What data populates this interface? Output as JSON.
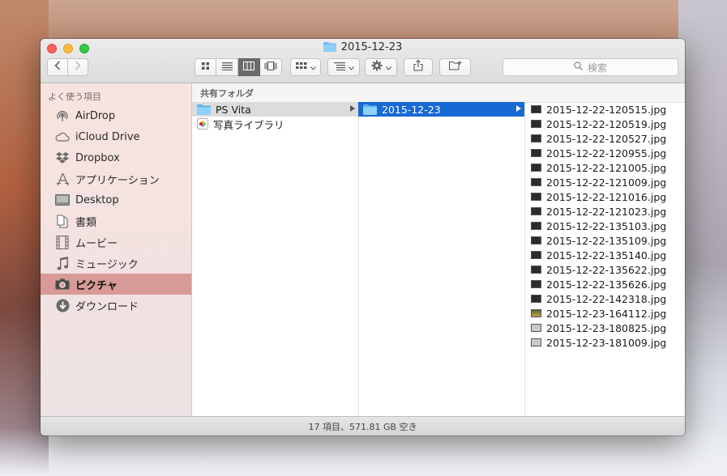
{
  "window": {
    "title": "2015-12-23"
  },
  "toolbar": {
    "back_icon": "chevron-left-icon",
    "forward_icon": "chevron-right-icon",
    "view_modes": [
      "icon-view-icon",
      "list-view-icon",
      "column-view-icon",
      "coverflow-view-icon"
    ],
    "active_view": "column-view-icon",
    "search_placeholder": "検索"
  },
  "sidebar": {
    "heading": "よく使う項目",
    "items": [
      {
        "label": "AirDrop",
        "icon": "airdrop-icon"
      },
      {
        "label": "iCloud Drive",
        "icon": "cloud-icon"
      },
      {
        "label": "Dropbox",
        "icon": "dropbox-icon"
      },
      {
        "label": "アプリケーション",
        "icon": "applications-icon"
      },
      {
        "label": "Desktop",
        "icon": "desktop-icon"
      },
      {
        "label": "書類",
        "icon": "documents-icon"
      },
      {
        "label": "ムービー",
        "icon": "movies-icon"
      },
      {
        "label": "ミュージック",
        "icon": "music-icon"
      },
      {
        "label": "ピクチャ",
        "icon": "camera-icon",
        "selected": true
      },
      {
        "label": "ダウンロード",
        "icon": "download-icon"
      }
    ]
  },
  "browser": {
    "path_header": "共有フォルダ",
    "column1": [
      {
        "label": "PS Vita",
        "kind": "folder",
        "selected": true
      },
      {
        "label": "写真ライブラリ",
        "kind": "library"
      }
    ],
    "column2": [
      {
        "label": "2015-12-23",
        "kind": "folder",
        "selected": true
      }
    ],
    "files": [
      {
        "name": "2015-12-22-120515.jpg",
        "thumb": "dark"
      },
      {
        "name": "2015-12-22-120519.jpg",
        "thumb": "dark"
      },
      {
        "name": "2015-12-22-120527.jpg",
        "thumb": "dark"
      },
      {
        "name": "2015-12-22-120955.jpg",
        "thumb": "dark"
      },
      {
        "name": "2015-12-22-121005.jpg",
        "thumb": "dark"
      },
      {
        "name": "2015-12-22-121009.jpg",
        "thumb": "dark"
      },
      {
        "name": "2015-12-22-121016.jpg",
        "thumb": "dark"
      },
      {
        "name": "2015-12-22-121023.jpg",
        "thumb": "dark"
      },
      {
        "name": "2015-12-22-135103.jpg",
        "thumb": "dark"
      },
      {
        "name": "2015-12-22-135109.jpg",
        "thumb": "dark"
      },
      {
        "name": "2015-12-22-135140.jpg",
        "thumb": "dark"
      },
      {
        "name": "2015-12-22-135622.jpg",
        "thumb": "dark"
      },
      {
        "name": "2015-12-22-135626.jpg",
        "thumb": "dark"
      },
      {
        "name": "2015-12-22-142318.jpg",
        "thumb": "dark"
      },
      {
        "name": "2015-12-23-164112.jpg",
        "thumb": "scene"
      },
      {
        "name": "2015-12-23-180825.jpg",
        "thumb": "light"
      },
      {
        "name": "2015-12-23-181009.jpg",
        "thumb": "light"
      }
    ]
  },
  "status": {
    "text": "17 項目、571.81 GB 空き"
  },
  "colors": {
    "selection_blue": "#1769d4",
    "sidebar_selection": "#d89a96"
  }
}
